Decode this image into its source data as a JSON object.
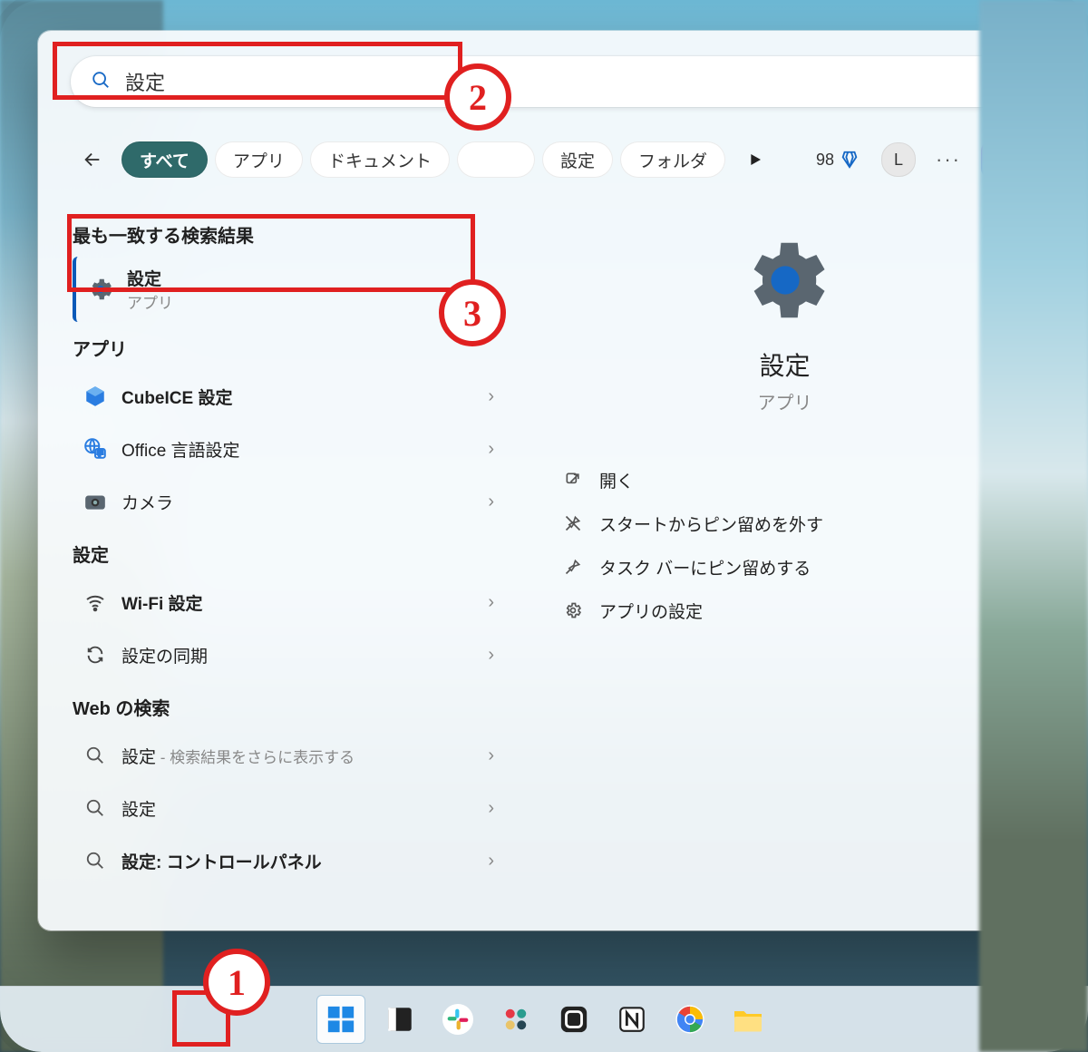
{
  "search": {
    "value": "設定"
  },
  "filters": {
    "all": "すべて",
    "apps": "アプリ",
    "docs": "ドキュメント",
    "sett": "設定",
    "fold": "フォルダ"
  },
  "rewards": {
    "count": "98",
    "avatar": "L"
  },
  "left": {
    "h_top": "最も一致する検索結果",
    "top": {
      "title": "設定",
      "sub": "アプリ"
    },
    "h_apps": "アプリ",
    "apps": [
      {
        "label": "CubeICE 設定"
      },
      {
        "label": "Office 言語設定"
      },
      {
        "label": "カメラ"
      }
    ],
    "h_set": "設定",
    "set": [
      {
        "label": "Wi-Fi 設定"
      },
      {
        "label": "設定の同期"
      }
    ],
    "h_web": "Web の検索",
    "web": [
      {
        "label": "設定",
        "hint": " - 検索結果をさらに表示する"
      },
      {
        "label": "設定",
        "hint": ""
      },
      {
        "label": "設定: コントロールパネル",
        "hint": ""
      }
    ]
  },
  "preview": {
    "title": "設定",
    "sub": "アプリ"
  },
  "actions": {
    "open": "開く",
    "unpin": "スタートからピン留めを外す",
    "pintb": "タスク バーにピン留めする",
    "appset": "アプリの設定"
  },
  "annotations": {
    "a1": "1",
    "a2": "2",
    "a3": "3"
  }
}
